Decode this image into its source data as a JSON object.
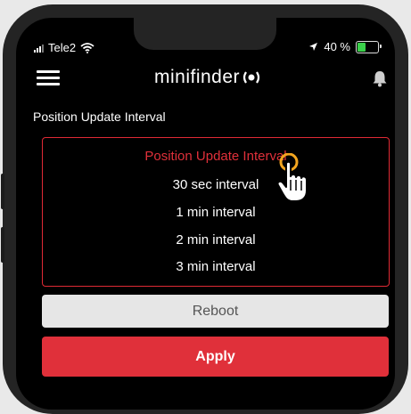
{
  "status_bar": {
    "carrier": "Tele2",
    "battery_text": "40 %",
    "battery_level": 0.4,
    "battery_color": "#3ad04a"
  },
  "header": {
    "logo_text": "minifinder"
  },
  "section": {
    "label": "Position Update Interval"
  },
  "picker": {
    "title": "Position Update Interval",
    "options": [
      "30 sec interval",
      "1 min interval",
      "2 min interval",
      "3 min interval"
    ]
  },
  "buttons": {
    "reboot": "Reboot",
    "apply": "Apply"
  },
  "colors": {
    "accent": "#e0303a",
    "background": "#000000"
  },
  "icons": [
    "signal-icon",
    "wifi-icon",
    "location-arrow-icon",
    "battery-icon",
    "menu-icon",
    "bell-icon",
    "hand-pointer-icon"
  ]
}
